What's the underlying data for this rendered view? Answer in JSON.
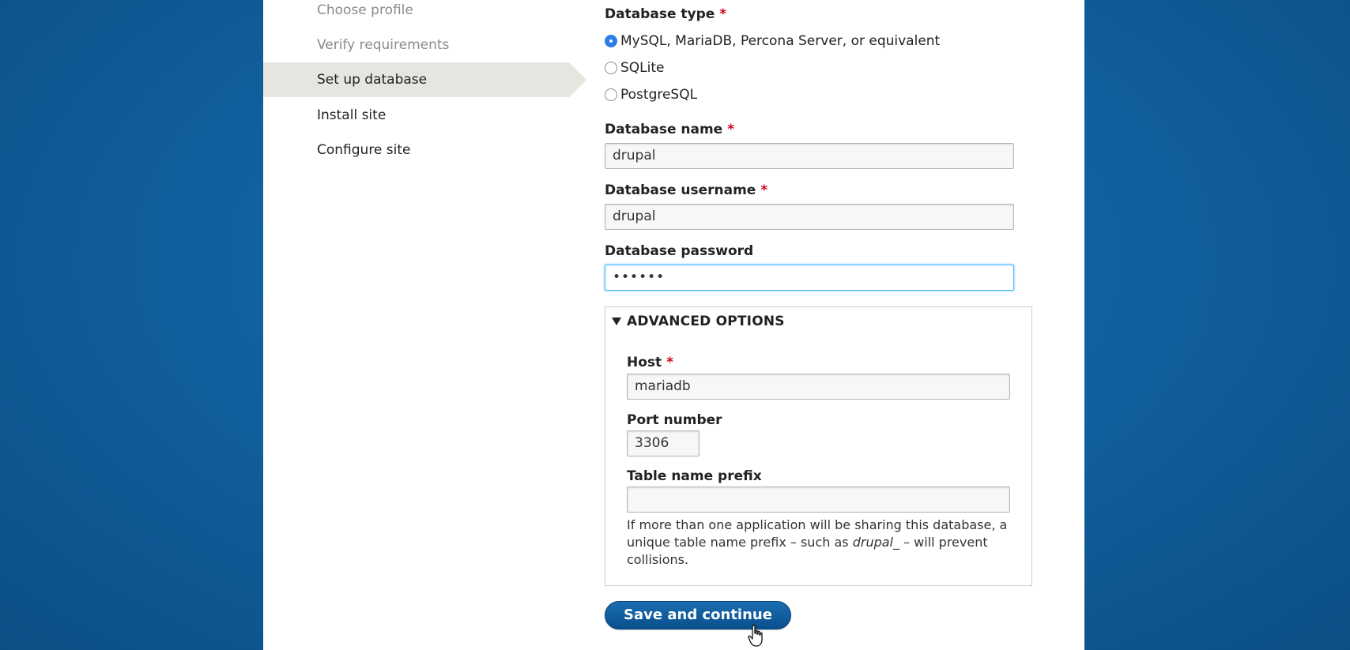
{
  "steps": [
    {
      "label": "Choose profile",
      "state": "done"
    },
    {
      "label": "Verify requirements",
      "state": "done"
    },
    {
      "label": "Set up database",
      "state": "active"
    },
    {
      "label": "Install site",
      "state": "pending"
    },
    {
      "label": "Configure site",
      "state": "pending"
    }
  ],
  "required_marker": "*",
  "db_type": {
    "label": "Database type",
    "options": [
      {
        "label": "MySQL, MariaDB, Percona Server, or equivalent",
        "checked": true
      },
      {
        "label": "SQLite",
        "checked": false
      },
      {
        "label": "PostgreSQL",
        "checked": false
      }
    ]
  },
  "db_name": {
    "label": "Database name",
    "value": "drupal"
  },
  "db_user": {
    "label": "Database username",
    "value": "drupal"
  },
  "db_pass": {
    "label": "Database password",
    "value": "••••••"
  },
  "advanced": {
    "legend": "ADVANCED OPTIONS",
    "host": {
      "label": "Host",
      "value": "mariadb"
    },
    "port": {
      "label": "Port number",
      "value": "3306"
    },
    "prefix": {
      "label": "Table name prefix",
      "value": "",
      "desc_1": "If more than one application will be sharing this database, a unique table name prefix – such as ",
      "desc_em": "drupal_",
      "desc_2": " – will prevent collisions."
    }
  },
  "submit_label": "Save and continue",
  "colors": {
    "accent": "#0d5c9e",
    "required": "#d0021b",
    "radio_checked": "#2b7de9",
    "background": "#11619f"
  }
}
